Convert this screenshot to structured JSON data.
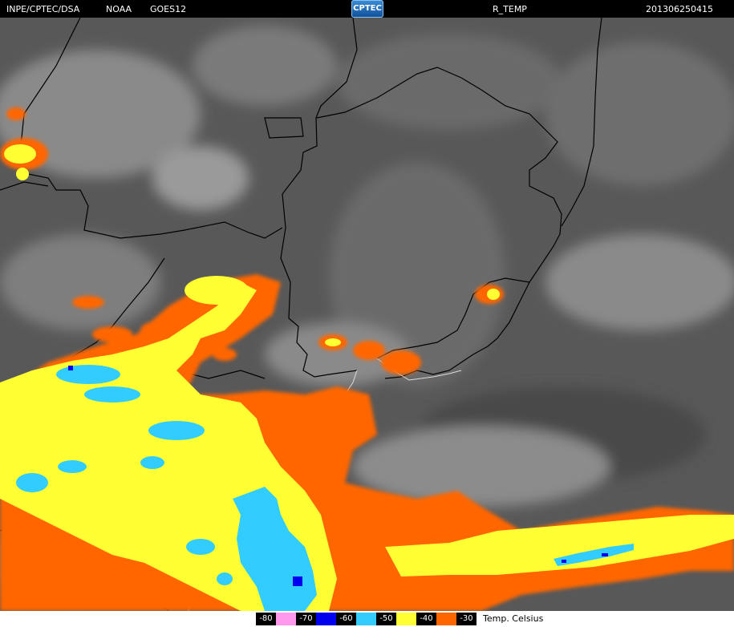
{
  "header": {
    "agency": "INPE/CPTEC/DSA",
    "org": "NOAA",
    "satellite": "GOES12",
    "logo": "CPTEC",
    "product": "R_TEMP",
    "timestamp": "201306250415"
  },
  "legend": {
    "unit": "Temp. Celsius",
    "items": [
      {
        "label": "-80",
        "color": "#ff99ee"
      },
      {
        "label": "-70",
        "color": "#0000ee"
      },
      {
        "label": "-60",
        "color": "#33ccff"
      },
      {
        "label": "-50",
        "color": "#ffff33"
      },
      {
        "label": "-40",
        "color": "#ff6600"
      },
      {
        "label": "-30",
        "color": ""
      }
    ]
  },
  "colors": {
    "background_ir": "#555555",
    "borders": "#000000"
  }
}
